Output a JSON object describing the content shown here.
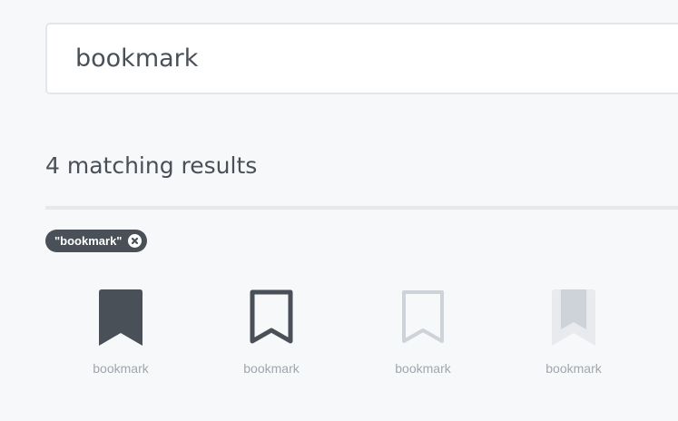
{
  "search": {
    "value": "bookmark"
  },
  "results": {
    "title": "4 matching results",
    "filter_chip": "\"bookmark\""
  },
  "icons": [
    {
      "name": "bookmark",
      "style": "solid",
      "color": "#495057"
    },
    {
      "name": "bookmark",
      "style": "outline",
      "color": "#495057"
    },
    {
      "name": "bookmark",
      "style": "outline-light",
      "color": "#ced3d9"
    },
    {
      "name": "bookmark",
      "style": "duotone",
      "color": "#ced3d9",
      "secondary_color": "#e8eaed"
    }
  ],
  "colors": {
    "background": "#f7f8fa",
    "text": "#495057",
    "muted": "#a0a6ad",
    "chip": "#495057"
  }
}
